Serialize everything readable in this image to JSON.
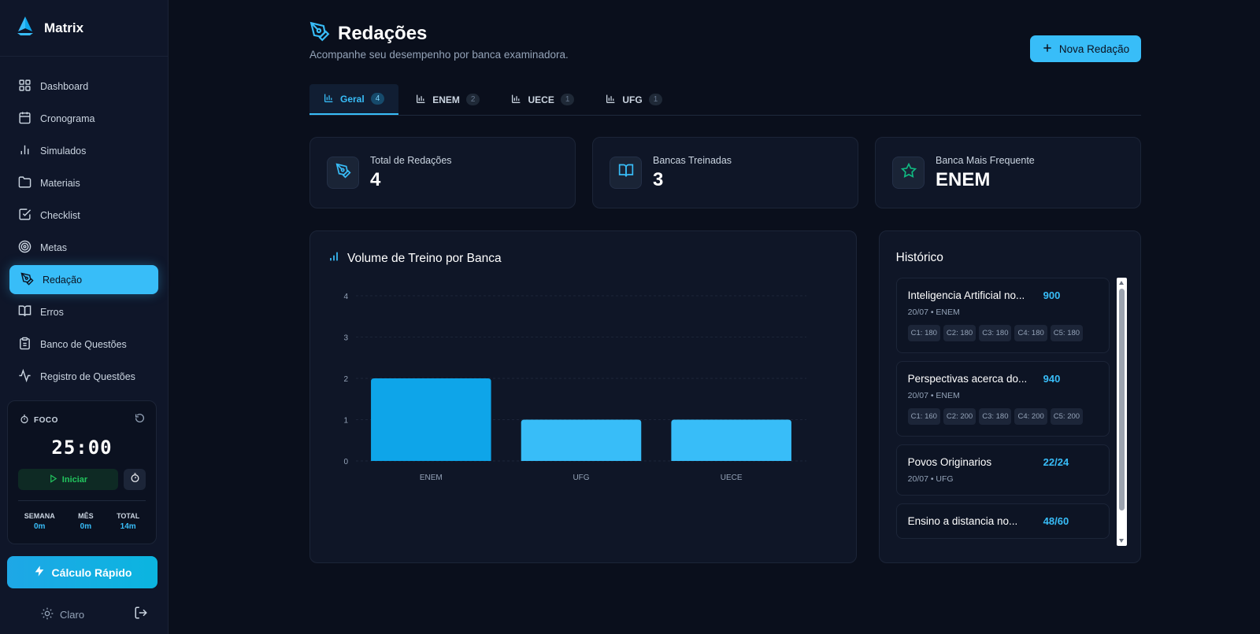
{
  "app": {
    "name": "Matrix"
  },
  "sidebar": {
    "items": [
      {
        "label": "Dashboard",
        "icon": "grid-icon"
      },
      {
        "label": "Cronograma",
        "icon": "calendar-icon"
      },
      {
        "label": "Simulados",
        "icon": "bar-chart-icon"
      },
      {
        "label": "Materiais",
        "icon": "folder-icon"
      },
      {
        "label": "Checklist",
        "icon": "checkbox-icon"
      },
      {
        "label": "Metas",
        "icon": "target-icon"
      },
      {
        "label": "Redação",
        "icon": "pen-tool-icon",
        "active": true
      },
      {
        "label": "Erros",
        "icon": "book-open-icon"
      },
      {
        "label": "Banco de Questões",
        "icon": "clipboard-icon"
      },
      {
        "label": "Registro de Questões",
        "icon": "activity-icon"
      }
    ],
    "focus": {
      "title": "FOCO",
      "timer": "25:00",
      "start_label": "Iniciar",
      "stats": [
        {
          "label": "SEMANA",
          "value": "0m"
        },
        {
          "label": "MÊS",
          "value": "0m"
        },
        {
          "label": "TOTAL",
          "value": "14m"
        }
      ]
    },
    "quick_calc_label": "Cálculo Rápido",
    "theme_label": "Claro"
  },
  "page": {
    "title": "Redações",
    "subtitle": "Acompanhe seu desempenho por banca examinadora.",
    "new_button": "Nova Redação"
  },
  "tabs": [
    {
      "label": "Geral",
      "count": "4",
      "active": true
    },
    {
      "label": "ENEM",
      "count": "2"
    },
    {
      "label": "UECE",
      "count": "1"
    },
    {
      "label": "UFG",
      "count": "1"
    }
  ],
  "cards": [
    {
      "label": "Total de Redações",
      "value": "4",
      "icon": "pen-tool-icon"
    },
    {
      "label": "Bancas Treinadas",
      "value": "3",
      "icon": "book-open-icon"
    },
    {
      "label": "Banca Mais Frequente",
      "value": "ENEM",
      "icon": "star-icon"
    }
  ],
  "chart_title": "Volume de Treino por Banca",
  "chart_data": {
    "type": "bar",
    "title": "Volume de Treino por Banca",
    "categories": [
      "ENEM",
      "UFG",
      "UECE"
    ],
    "values": [
      2,
      1,
      1
    ],
    "xlabel": "",
    "ylabel": "",
    "ylim": [
      0,
      4
    ],
    "yticks": [
      "0",
      "1",
      "2",
      "3",
      "4"
    ],
    "grid": true,
    "colors": [
      "#0ea5e9",
      "#38bdf8",
      "#38bdf8"
    ]
  },
  "history": {
    "title": "Histórico",
    "items": [
      {
        "name": "Inteligencia Artificial no...",
        "score": "900",
        "meta": "20/07 • ENEM",
        "chips": [
          "C1: 180",
          "C2: 180",
          "C3: 180",
          "C4: 180",
          "C5: 180"
        ]
      },
      {
        "name": "Perspectivas acerca do...",
        "score": "940",
        "meta": "20/07 • ENEM",
        "chips": [
          "C1: 160",
          "C2: 200",
          "C3: 180",
          "C4: 200",
          "C5: 200"
        ]
      },
      {
        "name": "Povos Originarios",
        "score": "22/24",
        "meta": "20/07 • UFG",
        "chips": []
      },
      {
        "name": "Ensino a distancia no...",
        "score": "48/60",
        "meta": "",
        "chips": []
      }
    ]
  },
  "colors": {
    "accent": "#38bdf8",
    "background": "#0a0f1c",
    "sidebar": "#0f1629",
    "success": "#22c55e"
  }
}
